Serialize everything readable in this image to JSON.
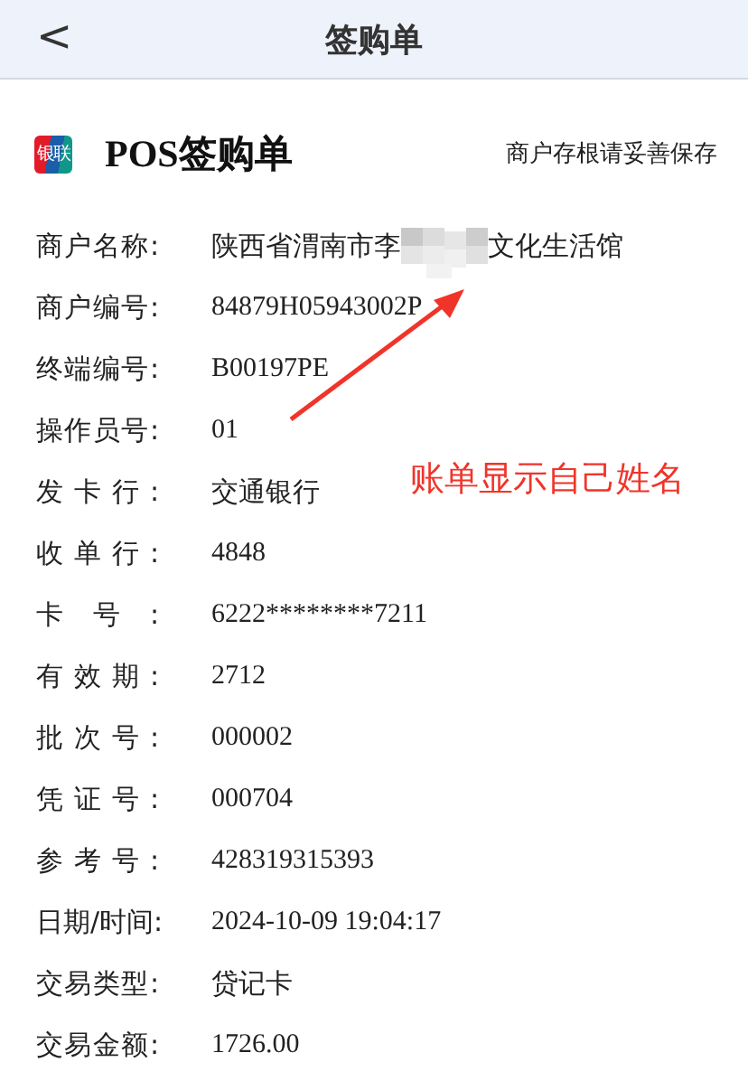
{
  "nav": {
    "back": "<",
    "title": "签购单"
  },
  "receipt": {
    "logo_text": "银联",
    "title": "POS签购单",
    "note": "商户存根请妥善保存"
  },
  "rows": [
    {
      "label": "商户名称:",
      "value": "陕西省渭南市李",
      "value_after": "文化生活馆"
    },
    {
      "label": "商户编号:",
      "value": "84879H05943002P"
    },
    {
      "label": "终端编号:",
      "value": "B00197PE"
    },
    {
      "label": "操作员号:",
      "value": "01"
    },
    {
      "label": "发卡行:",
      "value": "交通银行"
    },
    {
      "label": "收单行:",
      "value": "4848"
    },
    {
      "label": "卡号:",
      "value": "6222********7211"
    },
    {
      "label": "有效期:",
      "value": "2712"
    },
    {
      "label": "批次号:",
      "value": "000002"
    },
    {
      "label": "凭证号:",
      "value": "000704"
    },
    {
      "label": "参考号:",
      "value": "428319315393"
    },
    {
      "label": "日期/时间:",
      "value": "2024-10-09 19:04:17"
    },
    {
      "label": "交易类型:",
      "value": "贷记卡"
    },
    {
      "label": "交易金额:",
      "value": "1726.00"
    }
  ],
  "annotation": {
    "text": "账单显示自己姓名"
  }
}
